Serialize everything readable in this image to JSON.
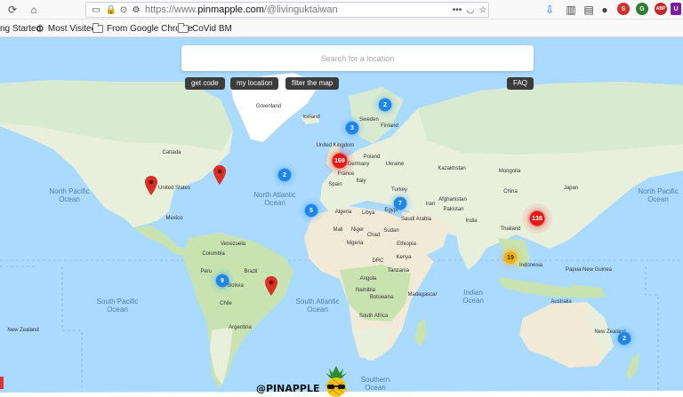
{
  "browser": {
    "url_prefix": "https://www.",
    "url_domain": "pinmapple.com",
    "url_path": "/@livinguktaiwan",
    "menu_dots": "•••",
    "extensions": [
      {
        "name": "S",
        "color": "#d32f2f"
      },
      {
        "name": "G",
        "color": "#2e7d32"
      },
      {
        "name": "ABP",
        "color": "#c62828"
      },
      {
        "name": "U",
        "color": "#7b1fa2"
      }
    ]
  },
  "bookmarks": [
    {
      "label": "ng Started"
    },
    {
      "label": "Most Visited"
    },
    {
      "label": "From Google Chrome"
    },
    {
      "label": "CoVid BM"
    }
  ],
  "search": {
    "placeholder": "Search for a location"
  },
  "buttons": {
    "get_code": "get code",
    "my_location": "my location",
    "filter_map": "filter the map",
    "faq": "FAQ"
  },
  "clusters": [
    {
      "label": "2",
      "color": "blue"
    },
    {
      "label": "3",
      "color": "blue"
    },
    {
      "label": "2",
      "color": "blue"
    },
    {
      "label": "5",
      "color": "blue"
    },
    {
      "label": "7",
      "color": "blue"
    },
    {
      "label": "9",
      "color": "blue"
    },
    {
      "label": "2",
      "color": "blue"
    },
    {
      "label": "169",
      "color": "red"
    },
    {
      "label": "138",
      "color": "red"
    },
    {
      "label": "19",
      "color": "yellow"
    }
  ],
  "map_labels": {
    "canada": "Canada",
    "united_states": "United States",
    "mexico": "Mexico",
    "venezuela": "Venezuela",
    "colombia": "Colombia",
    "peru": "Peru",
    "brazil": "Brazil",
    "bolivia": "Bolivia",
    "chile": "Chile",
    "argentina": "Argentina",
    "greenland": "Greenland",
    "iceland": "Iceland",
    "sweden": "Sweden",
    "finland": "Finland",
    "united_kingdom": "United Kingdom",
    "poland": "Poland",
    "germany": "Germany",
    "france": "France",
    "spain": "Spain",
    "italy": "Italy",
    "ukraine": "Ukraine",
    "turkey": "Turkey",
    "iran": "Iran",
    "kazakhstan": "Kazakhstan",
    "mongolia": "Mongolia",
    "china": "China",
    "japan": "Japan",
    "afghanistan": "Afghanistan",
    "pakistan": "Pakistan",
    "india": "India",
    "saudi_arabia": "Saudi Arabia",
    "egypt": "Egypt",
    "libya": "Libya",
    "algeria": "Algeria",
    "mali": "Mali",
    "niger": "Niger",
    "chad": "Chad",
    "sudan": "Sudan",
    "nigeria": "Nigeria",
    "ethiopia": "Ethiopia",
    "kenya": "Kenya",
    "drc": "DRC",
    "tanzania": "Tanzania",
    "angola": "Angola",
    "namibia": "Namibia",
    "botswana": "Botswana",
    "south_africa": "South Africa",
    "madagascar": "Madagascar",
    "thailand": "Thailand",
    "indonesia": "Indonesia",
    "papua_new_guinea": "Papua New Guinea",
    "australia": "Australia",
    "new_zealand": "New Zealand"
  },
  "oceans": {
    "north_pacific_w": "Ocean",
    "north_pacific_e": "Ocean",
    "north_atlantic": "Ocean",
    "south_pacific": "Ocean",
    "south_atlantic": "Ocean",
    "indian": "Ocean",
    "southern": "Ocean"
  },
  "oceans_top": {
    "north_pacific_w": "North Pacific",
    "north_pacific_e": "North Pacific",
    "north_atlantic": "North Atlantic",
    "south_pacific": "South Pacific",
    "south_atlantic": "South Atlantic",
    "indian": "Indian",
    "southern": "Southern"
  },
  "logo": {
    "text": "@PINAPPLE"
  },
  "colors": {
    "water": "#aadaff",
    "land": "#e8f0db",
    "forest": "#c8e3b0",
    "desert": "#f0ead6",
    "ice": "#ffffff"
  }
}
